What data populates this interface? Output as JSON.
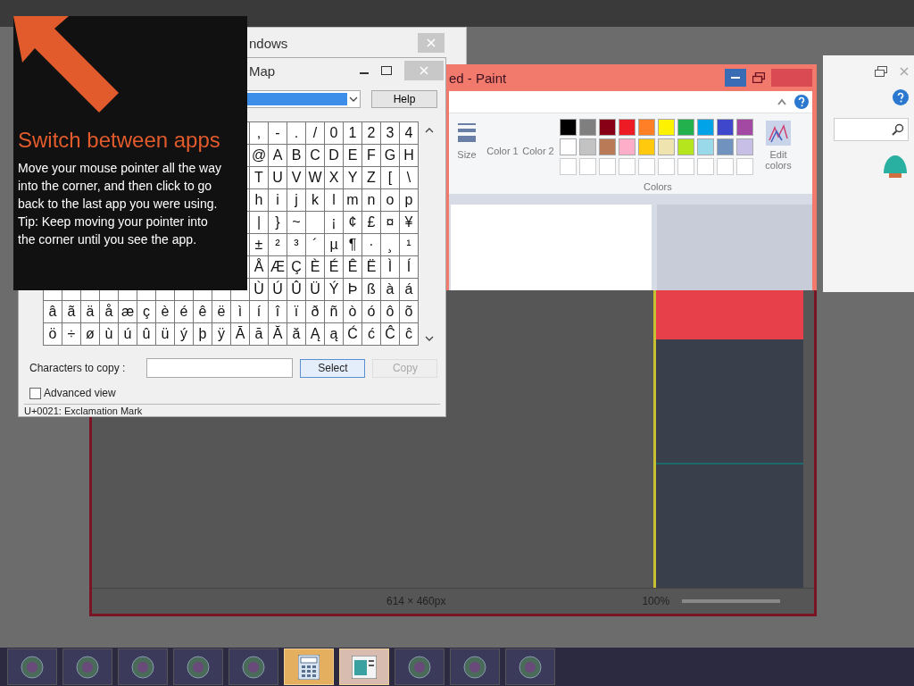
{
  "background_window": {
    "title": "ndows"
  },
  "tooltip": {
    "title": "Switch between apps",
    "body": "Move your mouse pointer all the way into the corner, and then click to go back to the last app you were using.",
    "tip": "Tip: Keep moving your pointer into the corner until you see the app."
  },
  "character_map": {
    "title": "Map",
    "help_button": "Help",
    "grid_rows": [
      {
        "cells": [
          ",",
          "-",
          ".",
          "/",
          "0",
          "1",
          "2",
          "3",
          "4"
        ]
      },
      {
        "cells": [
          "@",
          "A",
          "B",
          "C",
          "D",
          "E",
          "F",
          "G",
          "H"
        ]
      },
      {
        "cells": [
          "T",
          "U",
          "V",
          "W",
          "X",
          "Y",
          "Z",
          "[",
          "\\"
        ]
      },
      {
        "cells": [
          "h",
          "i",
          "j",
          "k",
          "l",
          "m",
          "n",
          "o",
          "p"
        ]
      },
      {
        "cells": [
          "|",
          "}",
          "~",
          null,
          "¡",
          "¢",
          "£",
          "¤",
          "¥"
        ]
      },
      {
        "cells": [
          "±",
          "²",
          "³",
          "´",
          "µ",
          "¶",
          "·",
          "¸",
          "¹"
        ]
      },
      {
        "cells": [
          "Å",
          "Æ",
          "Ç",
          "È",
          "É",
          "Ê",
          "Ë",
          "Ì",
          "Í"
        ]
      },
      {
        "cells": [
          "Ù",
          "Ú",
          "Û",
          "Ü",
          "Ý",
          "Þ",
          "ß",
          "à",
          "á"
        ]
      },
      {
        "cells": [
          "â",
          "ã",
          "ä",
          "å",
          "æ",
          "ç",
          "è",
          "é",
          "ê",
          "ë",
          "ì",
          "í",
          "î",
          "ï",
          "ð",
          "ñ",
          "ò",
          "ó",
          "ô",
          "õ"
        ]
      },
      {
        "cells": [
          "ö",
          "÷",
          "ø",
          "ù",
          "ú",
          "û",
          "ü",
          "ý",
          "þ",
          "ÿ",
          "Ā",
          "ā",
          "Ă",
          "ă",
          "Ą",
          "ą",
          "Ć",
          "ć",
          "Ĉ",
          "ĉ"
        ]
      }
    ],
    "characters_to_copy_label": "Characters to copy :",
    "select_button": {
      "label": "Select",
      "disabled": false
    },
    "copy_button": {
      "label": "Copy",
      "disabled": true
    },
    "advanced_view": {
      "label": "Advanced view",
      "checked": false
    },
    "status": "U+0021: Exclamation Mark"
  },
  "paint": {
    "title": "ed - Paint",
    "size_label": "Size",
    "color_1_label": "Color 1",
    "color_2_label": "Color 2",
    "palette": [
      {
        "color": "#000000"
      },
      {
        "color": "#7f7f7f"
      },
      {
        "color": "#880015"
      },
      {
        "color": "#ed1c24"
      },
      {
        "color": "#ff7f27"
      },
      {
        "color": "#fff200"
      },
      {
        "color": "#22b14c"
      },
      {
        "color": "#00a2e8"
      },
      {
        "color": "#3f48cc"
      },
      {
        "color": "#a349a4"
      },
      {
        "color": "#ffffff"
      },
      {
        "color": "#c3c3c3"
      },
      {
        "color": "#b97a57"
      },
      {
        "color": "#ffaec9"
      },
      {
        "color": "#ffc90e"
      },
      {
        "color": "#efe4b0"
      },
      {
        "color": "#b5e61d"
      },
      {
        "color": "#99d9ea"
      },
      {
        "color": "#7092be"
      },
      {
        "color": "#c8bfe7"
      }
    ],
    "edit_colors_label": "Edit colors",
    "colors_group_label": "Colors",
    "canvas_size": "614 × 460px",
    "zoom": "100%"
  },
  "taskbar": {
    "apps": [
      {
        "kind": "round",
        "selected": false
      },
      {
        "kind": "round",
        "selected": false
      },
      {
        "kind": "round",
        "selected": false
      },
      {
        "kind": "round",
        "selected": false
      },
      {
        "kind": "round",
        "selected": false
      },
      {
        "kind": "calculator",
        "selected": true
      },
      {
        "kind": "window",
        "selected": true
      },
      {
        "kind": "round",
        "selected": false
      },
      {
        "kind": "round",
        "selected": false
      },
      {
        "kind": "round",
        "selected": false
      }
    ]
  }
}
